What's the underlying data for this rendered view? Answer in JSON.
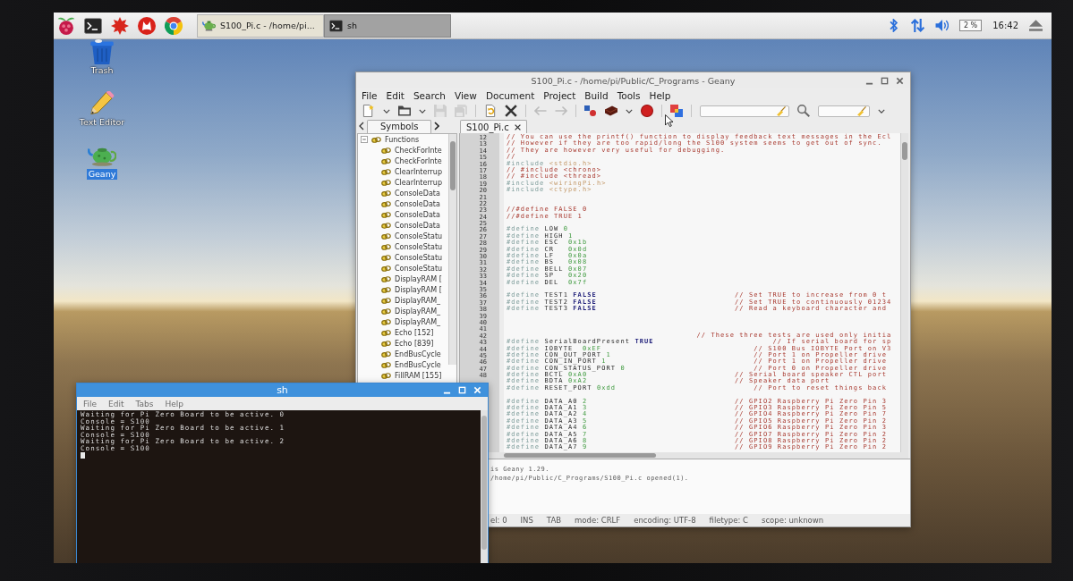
{
  "taskbar": {
    "launchers": [
      {
        "kind": "menu"
      },
      {
        "kind": "terminal"
      },
      {
        "kind": "burst"
      },
      {
        "kind": "wolf"
      },
      {
        "kind": "browser"
      }
    ],
    "tasks": [
      {
        "kind": "editor",
        "label": "S100_Pi.c - /home/pi...",
        "selected": false
      },
      {
        "kind": "terminal",
        "label": "sh",
        "selected": true
      }
    ],
    "tray": [
      {
        "kind": "bluetooth"
      },
      {
        "kind": "network"
      },
      {
        "kind": "volume"
      },
      {
        "kind": "cpu",
        "text": "2 %"
      },
      {
        "kind": "clock",
        "text": "16:42"
      },
      {
        "kind": "eject"
      }
    ]
  },
  "desktop_icons": [
    {
      "kind": "trash",
      "label": "Trash",
      "selected": false
    },
    {
      "kind": "text-editor",
      "label": "Text Editor",
      "selected": false
    },
    {
      "kind": "geany",
      "label": "Geany",
      "selected": true
    }
  ],
  "geany": {
    "title": "S100_Pi.c - /home/pi/Public/C_Programs - Geany",
    "active": false,
    "menu": [
      "File",
      "Edit",
      "Search",
      "View",
      "Document",
      "Project",
      "Build",
      "Tools",
      "Help"
    ],
    "toolbar": [
      [
        {
          "kind": "new",
          "disabled": false
        },
        {
          "kind": "caret",
          "disabled": false
        },
        {
          "kind": "open",
          "disabled": false
        },
        {
          "kind": "caret",
          "disabled": false
        },
        {
          "kind": "save",
          "disabled": true
        },
        {
          "kind": "save-all",
          "disabled": true
        }
      ],
      [
        {
          "kind": "reload",
          "disabled": false
        },
        {
          "kind": "close",
          "disabled": false
        }
      ],
      [
        {
          "kind": "back",
          "disabled": true
        },
        {
          "kind": "forward",
          "disabled": true
        }
      ],
      [
        {
          "kind": "compile",
          "disabled": false
        },
        {
          "kind": "build",
          "disabled": false
        },
        {
          "kind": "caret",
          "disabled": false
        },
        {
          "kind": "run",
          "disabled": false
        }
      ],
      [
        {
          "kind": "color",
          "disabled": false
        }
      ],
      [
        {
          "kind": "search-field",
          "disabled": false
        },
        {
          "kind": "search",
          "disabled": false
        },
        {
          "kind": "line-field",
          "disabled": false
        },
        {
          "kind": "caret",
          "disabled": false
        }
      ]
    ],
    "sidebar": {
      "tabs": [
        {
          "label": "Symbols",
          "selected": true
        }
      ],
      "tree": [
        {
          "label": "Functions",
          "expanded": true,
          "children": [
            {
              "label": "CheckForInte"
            },
            {
              "label": "CheckForInte"
            },
            {
              "label": "ClearInterrup"
            },
            {
              "label": "ClearInterrup"
            },
            {
              "label": "ConsoleData"
            },
            {
              "label": "ConsoleData"
            },
            {
              "label": "ConsoleData"
            },
            {
              "label": "ConsoleData"
            },
            {
              "label": "ConsoleStatu"
            },
            {
              "label": "ConsoleStatu"
            },
            {
              "label": "ConsoleStatu"
            },
            {
              "label": "ConsoleStatu"
            },
            {
              "label": "DisplayRAM ["
            },
            {
              "label": "DisplayRAM ["
            },
            {
              "label": "DisplayRAM_"
            },
            {
              "label": "DisplayRAM_"
            },
            {
              "label": "DisplayRAM_"
            },
            {
              "label": "Echo [152]"
            },
            {
              "label": "Echo [839]"
            },
            {
              "label": "EndBusCycle"
            },
            {
              "label": "EndBusCycle"
            },
            {
              "label": "FillRAM [155]"
            }
          ]
        }
      ]
    },
    "editor": {
      "tabs": [
        {
          "label": "S100_Pi.c",
          "selected": true
        }
      ],
      "lines": [
        {
          "kind": "code",
          "number": "12",
          "tokens": [
            {
              "kind": "comment",
              "text": "// You can use the printf() function to display feedback text messages in the Ecl"
            }
          ]
        },
        {
          "kind": "code",
          "number": "13",
          "tokens": [
            {
              "kind": "comment",
              "text": "// However if they are too rapid/long the S100 system seems to get out of sync."
            }
          ]
        },
        {
          "kind": "code",
          "number": "14",
          "tokens": [
            {
              "kind": "comment",
              "text": "// They are however very useful for debugging."
            }
          ]
        },
        {
          "kind": "code",
          "number": "15",
          "tokens": [
            {
              "kind": "comment",
              "text": "//"
            }
          ]
        },
        {
          "kind": "code",
          "number": "16",
          "tokens": [
            {
              "kind": "preproc",
              "text": "#include "
            },
            {
              "kind": "string",
              "text": "<stdio.h>"
            }
          ]
        },
        {
          "kind": "code",
          "number": "17",
          "tokens": [
            {
              "kind": "comment",
              "text": "// #include <chrono>"
            }
          ]
        },
        {
          "kind": "code",
          "number": "18",
          "tokens": [
            {
              "kind": "comment",
              "text": "// #include <thread>"
            }
          ]
        },
        {
          "kind": "code",
          "number": "19",
          "tokens": [
            {
              "kind": "preproc",
              "text": "#include "
            },
            {
              "kind": "string",
              "text": "<wiringPi.h>"
            }
          ]
        },
        {
          "kind": "code",
          "number": "20",
          "tokens": [
            {
              "kind": "preproc",
              "text": "#include "
            },
            {
              "kind": "string",
              "text": "<ctype.h>"
            }
          ]
        },
        {
          "kind": "blank",
          "number": "21"
        },
        {
          "kind": "blank",
          "number": "22"
        },
        {
          "kind": "code",
          "number": "23",
          "tokens": [
            {
              "kind": "comment",
              "text": "//#define FALSE 0"
            }
          ]
        },
        {
          "kind": "code",
          "number": "24",
          "tokens": [
            {
              "kind": "comment",
              "text": "//#define TRUE 1"
            }
          ]
        },
        {
          "kind": "blank",
          "number": "25"
        },
        {
          "kind": "code",
          "number": "26",
          "tokens": [
            {
              "kind": "preproc",
              "text": "#define "
            },
            {
              "kind": "plain",
              "text": "LOW "
            },
            {
              "kind": "number",
              "text": "0"
            }
          ]
        },
        {
          "kind": "code",
          "number": "27",
          "tokens": [
            {
              "kind": "preproc",
              "text": "#define "
            },
            {
              "kind": "plain",
              "text": "HIGH "
            },
            {
              "kind": "number",
              "text": "1"
            }
          ]
        },
        {
          "kind": "code",
          "number": "28",
          "tokens": [
            {
              "kind": "preproc",
              "text": "#define "
            },
            {
              "kind": "plain",
              "text": "ESC  "
            },
            {
              "kind": "number",
              "text": "0x1b"
            }
          ]
        },
        {
          "kind": "code",
          "number": "29",
          "tokens": [
            {
              "kind": "preproc",
              "text": "#define "
            },
            {
              "kind": "plain",
              "text": "CR   "
            },
            {
              "kind": "number",
              "text": "0x0d"
            }
          ]
        },
        {
          "kind": "code",
          "number": "30",
          "tokens": [
            {
              "kind": "preproc",
              "text": "#define "
            },
            {
              "kind": "plain",
              "text": "LF   "
            },
            {
              "kind": "number",
              "text": "0x0a"
            }
          ]
        },
        {
          "kind": "code",
          "number": "31",
          "tokens": [
            {
              "kind": "preproc",
              "text": "#define "
            },
            {
              "kind": "plain",
              "text": "BS   "
            },
            {
              "kind": "number",
              "text": "0x08"
            }
          ]
        },
        {
          "kind": "code",
          "number": "32",
          "tokens": [
            {
              "kind": "preproc",
              "text": "#define "
            },
            {
              "kind": "plain",
              "text": "BELL "
            },
            {
              "kind": "number",
              "text": "0x07"
            }
          ]
        },
        {
          "kind": "code",
          "number": "33",
          "tokens": [
            {
              "kind": "preproc",
              "text": "#define "
            },
            {
              "kind": "plain",
              "text": "SP   "
            },
            {
              "kind": "number",
              "text": "0x20"
            }
          ]
        },
        {
          "kind": "code",
          "number": "34",
          "tokens": [
            {
              "kind": "preproc",
              "text": "#define "
            },
            {
              "kind": "plain",
              "text": "DEL  "
            },
            {
              "kind": "number",
              "text": "0x7f"
            }
          ]
        },
        {
          "kind": "blank",
          "number": "35"
        },
        {
          "kind": "code",
          "number": "36",
          "tokens": [
            {
              "kind": "preproc",
              "text": "#define "
            },
            {
              "kind": "plain",
              "text": "TEST1 "
            },
            {
              "kind": "keyword",
              "text": "FALSE"
            },
            {
              "kind": "comment",
              "text": "                             // Set TRUE to increase from 0 t"
            }
          ]
        },
        {
          "kind": "code",
          "number": "37",
          "tokens": [
            {
              "kind": "preproc",
              "text": "#define "
            },
            {
              "kind": "plain",
              "text": "TEST2 "
            },
            {
              "kind": "keyword",
              "text": "FALSE"
            },
            {
              "kind": "comment",
              "text": "                             // Set TRUE to continuously 01234"
            }
          ]
        },
        {
          "kind": "code",
          "number": "38",
          "tokens": [
            {
              "kind": "preproc",
              "text": "#define "
            },
            {
              "kind": "plain",
              "text": "TEST3 "
            },
            {
              "kind": "keyword",
              "text": "FALSE"
            },
            {
              "kind": "comment",
              "text": "                             // Read a keyboard character and"
            }
          ]
        },
        {
          "kind": "blank",
          "number": "39"
        },
        {
          "kind": "blank",
          "number": "40"
        },
        {
          "kind": "blank",
          "number": "41"
        },
        {
          "kind": "code",
          "number": "42",
          "tokens": [
            {
              "kind": "comment",
              "text": "                                        // These three tests are used only initia"
            }
          ]
        },
        {
          "kind": "code",
          "number": "43",
          "tokens": [
            {
              "kind": "preproc",
              "text": "#define "
            },
            {
              "kind": "plain",
              "text": "SerialBoardPresent "
            },
            {
              "kind": "keyword",
              "text": "TRUE"
            },
            {
              "kind": "comment",
              "text": "                         // If serial board for sp"
            }
          ]
        },
        {
          "kind": "code",
          "number": "44",
          "tokens": [
            {
              "kind": "preproc",
              "text": "#define "
            },
            {
              "kind": "plain",
              "text": "IOBYTE  "
            },
            {
              "kind": "number",
              "text": "0xEF"
            },
            {
              "kind": "comment",
              "text": "                                // S100 Bus IOBYTE Port on V3"
            }
          ]
        },
        {
          "kind": "code",
          "number": "45",
          "tokens": [
            {
              "kind": "preproc",
              "text": "#define "
            },
            {
              "kind": "plain",
              "text": "CON_OUT_PORT "
            },
            {
              "kind": "number",
              "text": "1"
            },
            {
              "kind": "comment",
              "text": "                              // Port 1 on Propeller drive"
            }
          ]
        },
        {
          "kind": "code",
          "number": "46",
          "tokens": [
            {
              "kind": "preproc",
              "text": "#define "
            },
            {
              "kind": "plain",
              "text": "CON_IN_PORT "
            },
            {
              "kind": "number",
              "text": "1"
            },
            {
              "kind": "comment",
              "text": "                               // Port 1 on Propeller drive"
            }
          ]
        },
        {
          "kind": "code",
          "number": "47",
          "tokens": [
            {
              "kind": "preproc",
              "text": "#define "
            },
            {
              "kind": "plain",
              "text": "CON_STATUS_PORT "
            },
            {
              "kind": "number",
              "text": "0"
            },
            {
              "kind": "comment",
              "text": "                           // Port 0 on Propeller drive"
            }
          ]
        },
        {
          "kind": "code",
          "number": "48",
          "tokens": [
            {
              "kind": "preproc",
              "text": "#define "
            },
            {
              "kind": "plain",
              "text": "BCTL "
            },
            {
              "kind": "number",
              "text": "0xA0"
            },
            {
              "kind": "comment",
              "text": "                               // Serial board speaker CTL port"
            }
          ]
        },
        {
          "kind": "code",
          "tokens": [
            {
              "kind": "preproc",
              "text": "#define "
            },
            {
              "kind": "plain",
              "text": "BDTA "
            },
            {
              "kind": "number",
              "text": "0xA2"
            },
            {
              "kind": "comment",
              "text": "                               // Speaker data port"
            }
          ]
        },
        {
          "kind": "code",
          "tokens": [
            {
              "kind": "preproc",
              "text": "#define "
            },
            {
              "kind": "plain",
              "text": "RESET_PORT "
            },
            {
              "kind": "number",
              "text": "0xdd"
            },
            {
              "kind": "comment",
              "text": "                             // Port to reset things back"
            }
          ]
        },
        {
          "kind": "blank"
        },
        {
          "kind": "code",
          "tokens": [
            {
              "kind": "preproc",
              "text": "#define "
            },
            {
              "kind": "plain",
              "text": "DATA_A0 "
            },
            {
              "kind": "number",
              "text": "2"
            },
            {
              "kind": "comment",
              "text": "                               // GPIO2 Raspberry Pi Zero Pin 3"
            }
          ]
        },
        {
          "kind": "code",
          "tokens": [
            {
              "kind": "preproc",
              "text": "#define "
            },
            {
              "kind": "plain",
              "text": "DATA_A1 "
            },
            {
              "kind": "number",
              "text": "3"
            },
            {
              "kind": "comment",
              "text": "                               // GPIO3 Raspberry Pi Zero Pin 5"
            }
          ]
        },
        {
          "kind": "code",
          "tokens": [
            {
              "kind": "preproc",
              "text": "#define "
            },
            {
              "kind": "plain",
              "text": "DATA_A2 "
            },
            {
              "kind": "number",
              "text": "4"
            },
            {
              "kind": "comment",
              "text": "                               // GPIO4 Raspberry Pi Zero Pin 7"
            }
          ]
        },
        {
          "kind": "code",
          "tokens": [
            {
              "kind": "preproc",
              "text": "#define "
            },
            {
              "kind": "plain",
              "text": "DATA_A3 "
            },
            {
              "kind": "number",
              "text": "5"
            },
            {
              "kind": "comment",
              "text": "                               // GPIO5 Raspberry Pi Zero Pin 2"
            }
          ]
        },
        {
          "kind": "code",
          "tokens": [
            {
              "kind": "preproc",
              "text": "#define "
            },
            {
              "kind": "plain",
              "text": "DATA_A4 "
            },
            {
              "kind": "number",
              "text": "6"
            },
            {
              "kind": "comment",
              "text": "                               // GPIO6 Raspberry Pi Zero Pin 3"
            }
          ]
        },
        {
          "kind": "code",
          "tokens": [
            {
              "kind": "preproc",
              "text": "#define "
            },
            {
              "kind": "plain",
              "text": "DATA_A5 "
            },
            {
              "kind": "number",
              "text": "7"
            },
            {
              "kind": "comment",
              "text": "                               // GPIO7 Raspberry Pi Zero Pin 2"
            }
          ]
        },
        {
          "kind": "code",
          "tokens": [
            {
              "kind": "preproc",
              "text": "#define "
            },
            {
              "kind": "plain",
              "text": "DATA_A6 "
            },
            {
              "kind": "number",
              "text": "8"
            },
            {
              "kind": "comment",
              "text": "                               // GPIO8 Raspberry Pi Zero Pin 2"
            }
          ]
        },
        {
          "kind": "code",
          "tokens": [
            {
              "kind": "preproc",
              "text": "#define "
            },
            {
              "kind": "plain",
              "text": "DATA_A7 "
            },
            {
              "kind": "number",
              "text": "9"
            },
            {
              "kind": "comment",
              "text": "                               // GPIO9 Raspberry Pi Zero Pin 2"
            }
          ]
        }
      ]
    },
    "messages": [
      "is Geany 1.29.",
      "/home/pi/Public/C_Programs/S100_Pi.c opened(1)."
    ],
    "status_bar": [
      "el: 0",
      "INS",
      "TAB",
      "mode: CRLF",
      "encoding: UTF-8",
      "filetype: C",
      "scope: unknown"
    ]
  },
  "terminal": {
    "title": "sh",
    "active": true,
    "menu": [
      "File",
      "Edit",
      "Tabs",
      "Help"
    ],
    "lines": [
      "Waiting for Pi Zero Board to be active. 0",
      "Console = S100",
      "Waiting for Pi Zero Board to be active. 1",
      "Console = S100",
      "Waiting for Pi Zero Board to be active. 2",
      "Console = S100"
    ]
  }
}
